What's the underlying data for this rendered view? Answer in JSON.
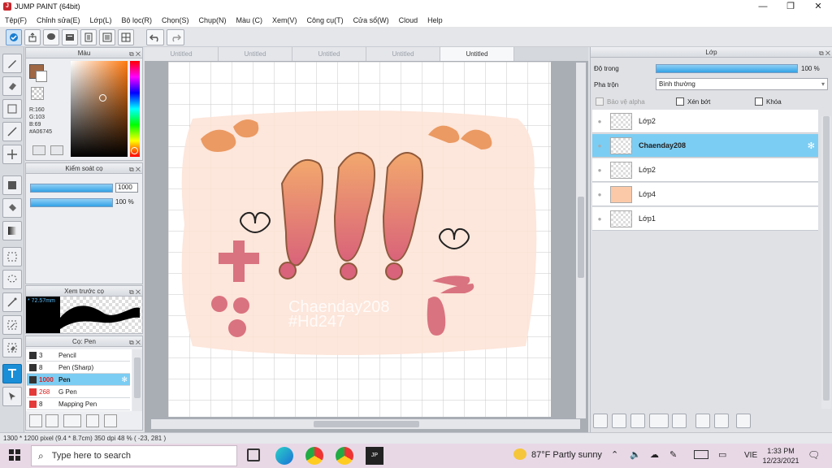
{
  "window": {
    "title": "JUMP PAINT (64bit)",
    "controls": [
      "—",
      "❐",
      "✕"
    ]
  },
  "menu": [
    "Tệp(F)",
    "Chỉnh sửa(E)",
    "Lớp(L)",
    "Bộ lọc(R)",
    "Chọn(S)",
    "Chụp(N)",
    "Màu (C)",
    "Xem(V)",
    "Công cụ(T)",
    "Cửa sổ(W)",
    "Cloud",
    "Help"
  ],
  "doc_tabs": [
    "Untitled",
    "Untitled",
    "Untitled",
    "Untitled",
    "Untitled"
  ],
  "color_panel": {
    "title": "Màu",
    "r": "R:160",
    "g": "G:103",
    "b": "B:69",
    "hex": "#A06745",
    "main_color": "#a06745"
  },
  "brush_control": {
    "title": "Kiểm soát cọ",
    "size": "1000",
    "opacity": "100 %"
  },
  "preview": {
    "title": "Xem trước cọ",
    "size_label": "* 72.57mm"
  },
  "brush_list": {
    "title": "Cọ: Pen",
    "items": [
      {
        "size": "3",
        "name": "Pencil",
        "color": "#333333"
      },
      {
        "size": "8",
        "name": "Pen (Sharp)",
        "color": "#333333"
      },
      {
        "size": "1000",
        "name": "Pen",
        "color": "#333333"
      },
      {
        "size": "268",
        "name": "G Pen",
        "color": "#e43a3a"
      },
      {
        "size": "8",
        "name": "Mapping Pen",
        "color": "#e43a3a"
      }
    ]
  },
  "layer_panel": {
    "title": "Lớp",
    "opacity_label": "Độ trong",
    "opacity_value": "100 %",
    "blend_label": "Pha trộn",
    "blend_value": "Bình thường",
    "protect_alpha": "Bảo vệ alpha",
    "clip": "Xén bớt",
    "lock": "Khóa",
    "layers": [
      "Lớp2",
      "Chaenday208",
      "Lớp2",
      "Lớp4",
      "Lớp1"
    ]
  },
  "canvas": {
    "watermark_line1": "Chaenday208",
    "watermark_line2": "#Hd247"
  },
  "status": {
    "text": "1300 * 1200 pixel   (9.4 * 8.7cm)   350 dpi   48 %   ( -23, 281 )"
  },
  "taskbar": {
    "search_placeholder": "Type here to search",
    "weather": "87°F  Partly sunny",
    "lang": "VIE",
    "time": "1:33 PM",
    "date": "12/23/2021"
  }
}
